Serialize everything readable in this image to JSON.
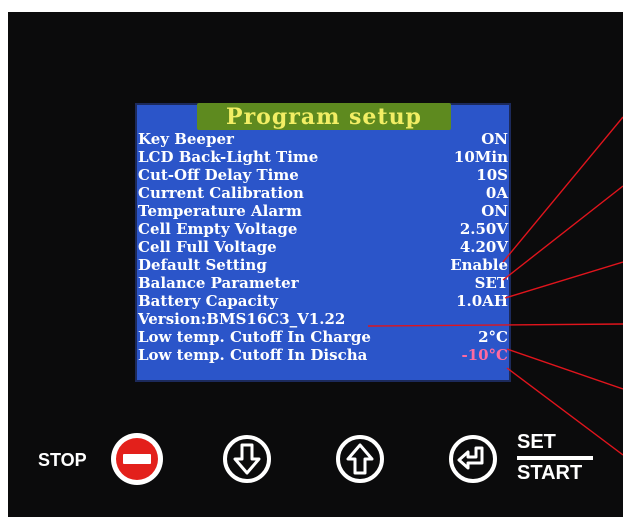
{
  "screen": {
    "title": "Program setup",
    "rows": [
      {
        "label": "Key Beeper",
        "value": "ON"
      },
      {
        "label": "LCD Back-Light Time",
        "value": "10Min"
      },
      {
        "label": "Cut-Off Delay Time",
        "value": "10S"
      },
      {
        "label": "Current Calibration",
        "value": "0A"
      },
      {
        "label": "Temperature Alarm",
        "value": "ON"
      },
      {
        "label": "Cell Empty Voltage",
        "value": "2.50V"
      },
      {
        "label": "Cell Full Voltage",
        "value": "4.20V"
      },
      {
        "label": "Default Setting",
        "value": "Enable"
      },
      {
        "label": "Balance Parameter",
        "value": "SET"
      },
      {
        "label": "Battery Capacity",
        "value": "1.0AH"
      },
      {
        "label": "Version:BMS16C3_V1.22",
        "value": ""
      },
      {
        "label": "Low temp. Cutoff In Charge",
        "value": "2°C"
      },
      {
        "label": "Low temp. Cutoff In Discha",
        "value": "-10°C"
      }
    ]
  },
  "buttons": {
    "stop_label": "STOP",
    "set_label": "SET",
    "start_label": "START",
    "stop_icon": "no-entry-icon",
    "down_icon": "arrow-down-icon",
    "up_icon": "arrow-up-icon",
    "enter_icon": "enter-return-icon"
  },
  "colors": {
    "screen_bg": "#2b55c9",
    "title_bg": "#5e8a1f",
    "title_text": "#f2ee64",
    "negative_value": "#ff6aa0",
    "stop_button": "#e3201b",
    "leader_lines": "#e0141c"
  }
}
